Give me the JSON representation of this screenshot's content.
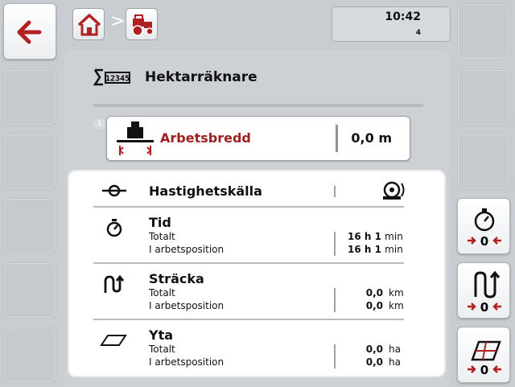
{
  "header": {
    "time": "10:42",
    "page_number": "4"
  },
  "title": "Hektarräknare",
  "parameter": {
    "badge": "1",
    "label": "Arbetsbredd",
    "value": "0,0 m"
  },
  "speed_source": {
    "label": "Hastighetskälla"
  },
  "sections": {
    "tid": {
      "title": "Tid",
      "totalt_label": "Totalt",
      "arbets_label": "I arbetsposition",
      "totalt_h": "16",
      "totalt_h_unit": "h",
      "totalt_min": "1",
      "totalt_min_unit": "min",
      "arbets_h": "16",
      "arbets_h_unit": "h",
      "arbets_min": "1",
      "arbets_min_unit": "min"
    },
    "stracka": {
      "title": "Sträcka",
      "totalt_label": "Totalt",
      "arbets_label": "I arbetsposition",
      "totalt_value": "0,0",
      "arbets_value": "0,0",
      "unit": "km"
    },
    "yta": {
      "title": "Yta",
      "totalt_label": "Totalt",
      "arbets_label": "I arbetsposition",
      "totalt_value": "0,0",
      "arbets_value": "0,0",
      "unit": "ha"
    }
  },
  "colors": {
    "accent_red": "#a0201f",
    "background": "#c9ccd0"
  },
  "icons": {
    "back": "back-arrow-icon",
    "home": "home-icon",
    "tractor": "tractor-icon",
    "sum": "sum-counter-icon",
    "implement": "implement-width-icon",
    "speed_source": "speed-source-icon",
    "sensor": "wheel-sensor-icon",
    "stopwatch": "stopwatch-icon",
    "distance": "distance-icon",
    "area": "area-icon",
    "reset_time": "reset-time-icon",
    "reset_distance": "reset-distance-icon",
    "reset_area": "reset-area-icon"
  }
}
